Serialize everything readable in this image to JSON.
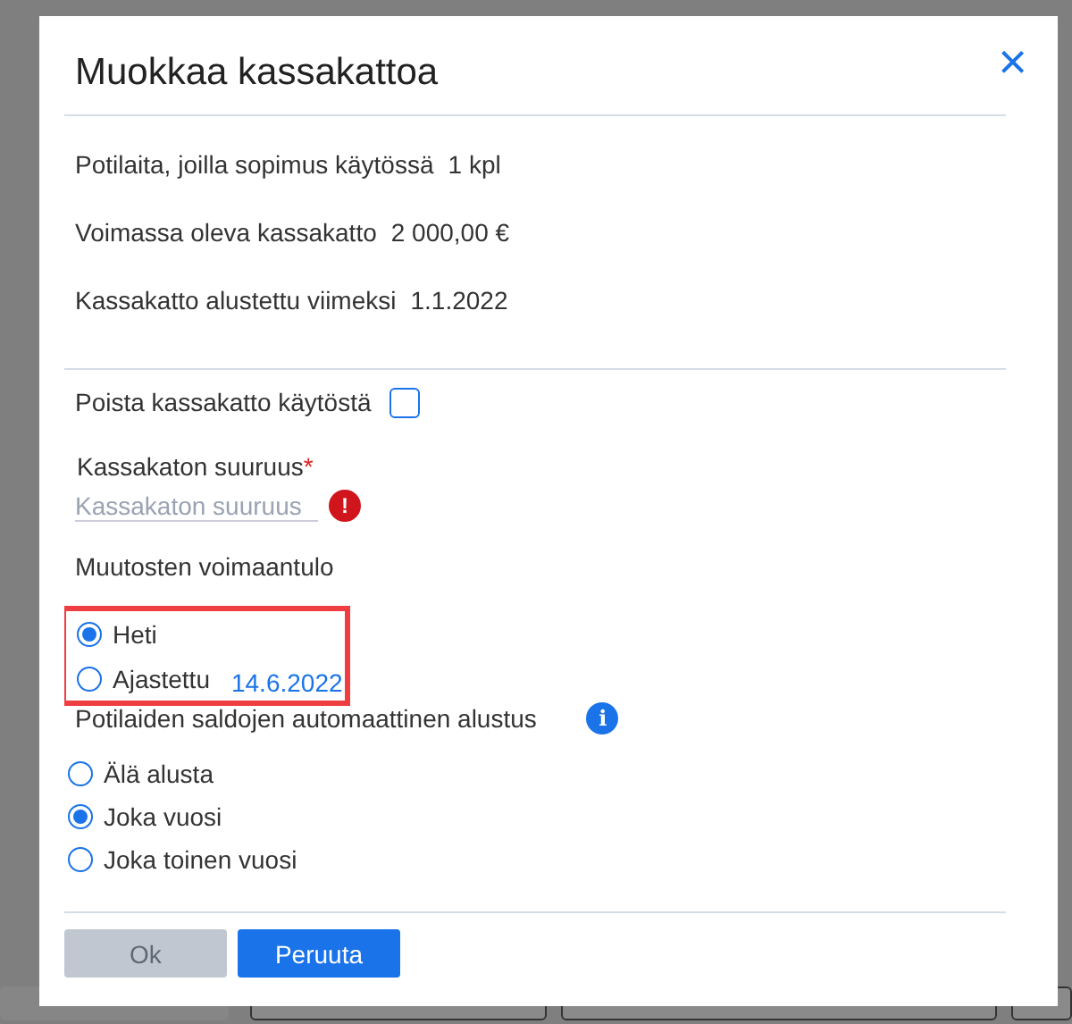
{
  "dialog": {
    "title": "Muokkaa kassakattoa",
    "close": "×",
    "info_rows": [
      {
        "label": "Potilaita, joilla sopimus käytössä",
        "value": "1 kpl"
      },
      {
        "label": "Voimassa oleva kassakatto",
        "value": "2 000,00 €"
      },
      {
        "label": "Kassakatto alustettu viimeksi",
        "value": "1.1.2022"
      }
    ],
    "disable_checkbox": {
      "label": "Poista kassakatto käytöstä",
      "checked": false
    },
    "size_field": {
      "label": "Kassakaton suuruus",
      "required_mark": "*",
      "placeholder": "Kassakaton suuruus",
      "error": true,
      "error_icon": "!"
    },
    "effective": {
      "label": "Muutosten voimaantulo",
      "highlighted": true,
      "options": [
        {
          "label": "Heti",
          "selected": true
        },
        {
          "label": "Ajastettu",
          "selected": false,
          "date": "14.6.2022"
        }
      ]
    },
    "reset": {
      "label": "Potilaiden saldojen automaattinen alustus",
      "info_icon": "i",
      "options": [
        {
          "label": "Älä alusta",
          "selected": false
        },
        {
          "label": "Joka vuosi",
          "selected": true
        },
        {
          "label": "Joka toinen vuosi",
          "selected": false
        }
      ]
    },
    "buttons": [
      {
        "label": "Ok",
        "disabled": true
      },
      {
        "label": "Peruuta",
        "disabled": false
      }
    ]
  }
}
